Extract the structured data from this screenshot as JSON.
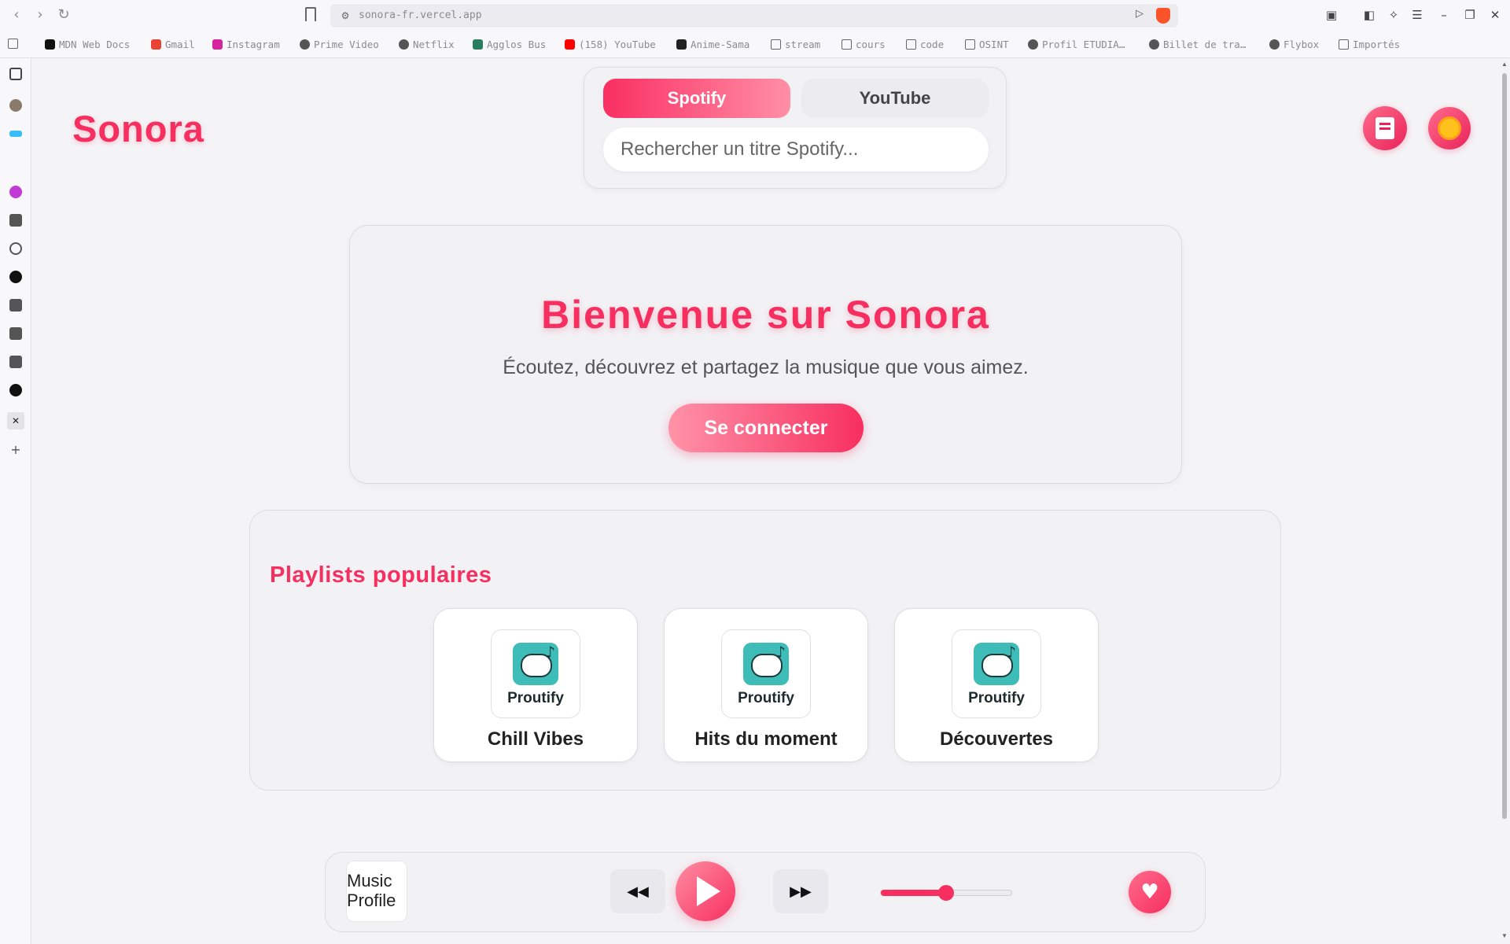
{
  "browser": {
    "url": "sonora-fr.vercel.app",
    "bookmarks": [
      {
        "label": "MDN Web Docs",
        "icon": "mdn-icon"
      },
      {
        "label": "Gmail",
        "icon": "gmail-icon"
      },
      {
        "label": "Instagram",
        "icon": "instagram-icon"
      },
      {
        "label": "Prime Video",
        "icon": "globe-icon"
      },
      {
        "label": "Netflix",
        "icon": "globe-icon"
      },
      {
        "label": "Agglos Bus",
        "icon": "bus-icon"
      },
      {
        "label": "(158) YouTube",
        "icon": "youtube-icon"
      },
      {
        "label": "Anime-Sama",
        "icon": "anime-icon"
      },
      {
        "label": "stream",
        "icon": "folder-icon"
      },
      {
        "label": "cours",
        "icon": "folder-icon"
      },
      {
        "label": "code",
        "icon": "folder-icon"
      },
      {
        "label": "OSINT",
        "icon": "folder-icon"
      },
      {
        "label": "Profil ETUDIA…",
        "icon": "globe-icon"
      },
      {
        "label": "Billet de tra…",
        "icon": "globe-icon"
      },
      {
        "label": "Flybox",
        "icon": "globe-icon"
      },
      {
        "label": "Importés",
        "icon": "folder-icon"
      }
    ]
  },
  "app": {
    "logo": "Sonora",
    "colors": {
      "accent": "#f72f60",
      "teal": "#3ebcb8"
    }
  },
  "search": {
    "tabs": [
      {
        "label": "Spotify",
        "active": true
      },
      {
        "label": "YouTube",
        "active": false
      }
    ],
    "placeholder": "Rechercher un titre Spotify..."
  },
  "header_buttons": {
    "book_icon": "book-icon",
    "theme_icon": "sun-icon"
  },
  "welcome": {
    "title": "Bienvenue sur Sonora",
    "subtitle": "Écoutez, découvrez et partagez la musique que vous aimez.",
    "login_label": "Se connecter"
  },
  "playlists": {
    "heading": "Playlists populaires",
    "items": [
      {
        "brand": "Proutify",
        "title": "Chill Vibes"
      },
      {
        "brand": "Proutify",
        "title": "Hits du moment"
      },
      {
        "brand": "Proutify",
        "title": "Découvertes"
      }
    ]
  },
  "player": {
    "image_alt": "Music Profile",
    "volume": 0.5
  }
}
